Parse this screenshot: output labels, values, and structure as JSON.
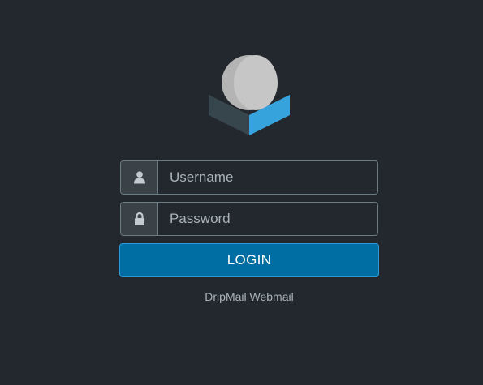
{
  "login": {
    "username_placeholder": "Username",
    "password_placeholder": "Password",
    "button_label": "LOGIN",
    "product_name": "DripMail Webmail"
  },
  "icons": {
    "logo": "roundcube-logo-icon",
    "username": "user-icon",
    "password": "lock-icon"
  },
  "colors": {
    "background": "#22282d",
    "accent": "#006ea3",
    "accent_border": "#2a9bd8",
    "logo_blue": "#37a3dd"
  }
}
